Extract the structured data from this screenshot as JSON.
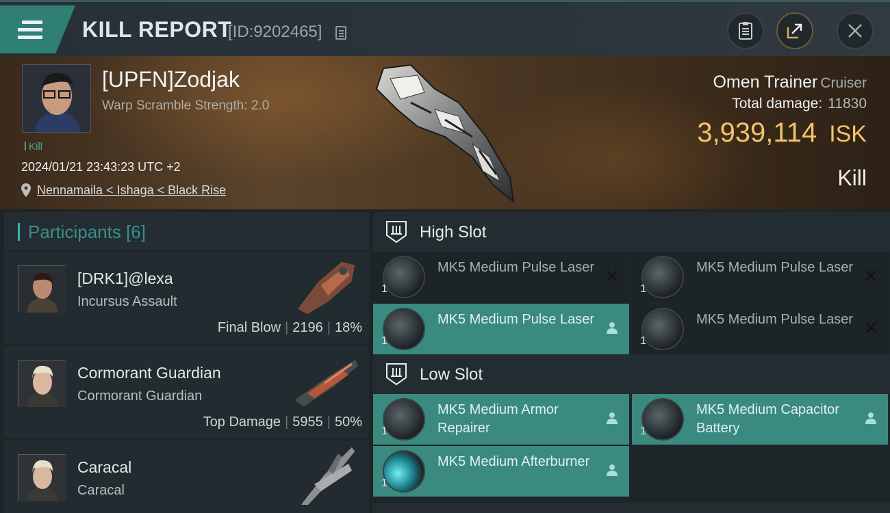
{
  "header": {
    "title": "KILL REPORT",
    "report_id": "[ID:9202465]",
    "icons": {
      "menu": "hamburger-menu-icon",
      "copy": "copy-icon",
      "clipboard": "clipboard-icon",
      "share": "share-icon",
      "close": "close-icon"
    }
  },
  "victim": {
    "pilot": "[UPFN]Zodjak",
    "warp_scramble": "Warp Scramble Strength: 2.0",
    "tag": "Kill",
    "datetime": "2024/01/21 23:43:23 UTC +2",
    "location": "Nennamaila < Ishaga < Black Rise",
    "ship_name": "Omen Trainer",
    "ship_class": "Cruiser",
    "total_damage_label": "Total damage:",
    "total_damage": "11830",
    "isk_value": "3,939,114",
    "isk_unit": "ISK",
    "result": "Kill"
  },
  "participants": {
    "title": "Participants",
    "count": "[6]",
    "rows": [
      {
        "name": "[DRK1]@lexa",
        "ship": "Incursus Assault",
        "stat_label": "Final Blow",
        "damage": "2196",
        "percent": "18%"
      },
      {
        "name": "Cormorant Guardian",
        "ship": "Cormorant Guardian",
        "stat_label": "Top Damage",
        "damage": "5955",
        "percent": "50%"
      },
      {
        "name": "Caracal",
        "ship": "Caracal",
        "stat_label": "",
        "damage": "",
        "percent": ""
      }
    ]
  },
  "slots": {
    "high": {
      "title": "High Slot",
      "modules": [
        {
          "name": "MK5 Medium Pulse Laser",
          "qty": "1",
          "state": "destroyed"
        },
        {
          "name": "MK5 Medium Pulse Laser",
          "qty": "1",
          "state": "destroyed"
        },
        {
          "name": "MK5 Medium Pulse Laser",
          "qty": "1",
          "state": "dropped"
        },
        {
          "name": "MK5 Medium Pulse Laser",
          "qty": "1",
          "state": "destroyed"
        }
      ]
    },
    "low": {
      "title": "Low Slot",
      "modules": [
        {
          "name": "MK5 Medium Armor Repairer",
          "qty": "1",
          "state": "dropped"
        },
        {
          "name": "MK5 Medium Capacitor Battery",
          "qty": "1",
          "state": "dropped"
        },
        {
          "name": "MK5 Medium Afterburner",
          "qty": "1",
          "state": "dropped"
        }
      ]
    }
  },
  "colors": {
    "accent": "#38b5a6",
    "dropped_bg": "#3a8a7f",
    "isk": "#f3c46a"
  }
}
